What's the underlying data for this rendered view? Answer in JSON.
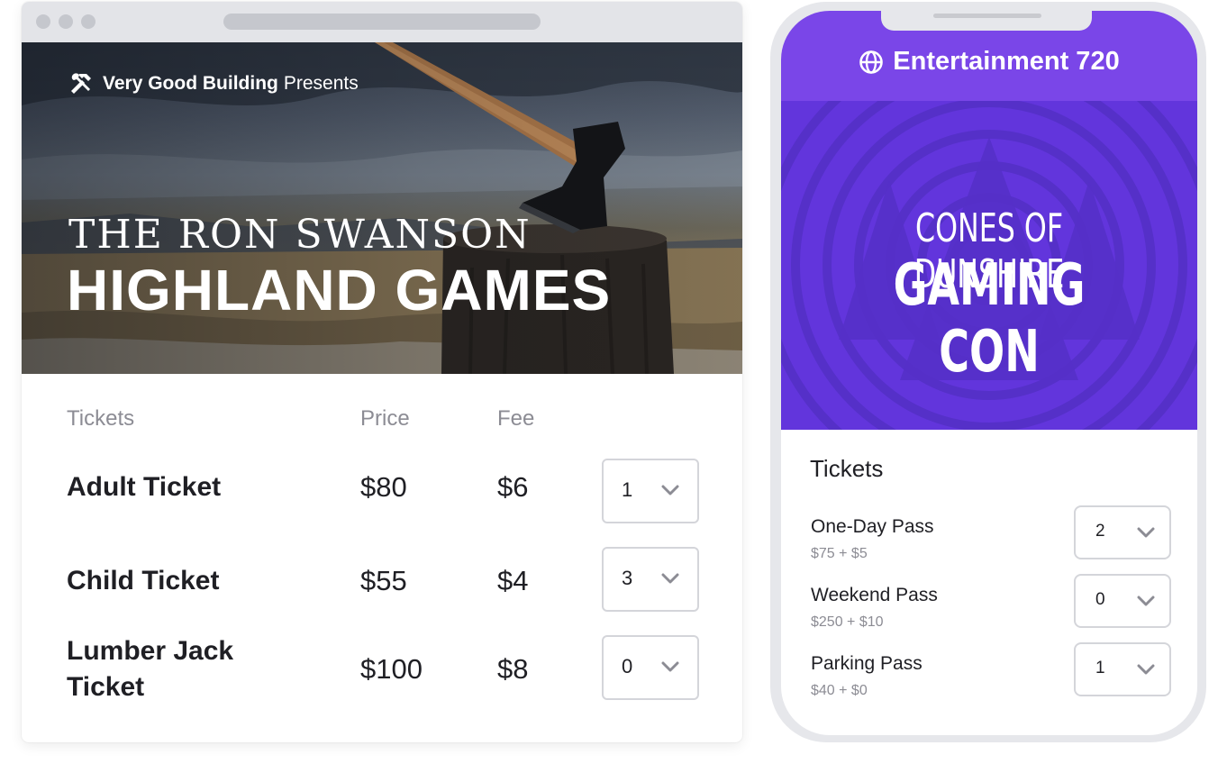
{
  "desktop": {
    "presenter": {
      "org": "Very Good Building",
      "suffix": "Presents"
    },
    "event": {
      "subtitle": "THE RON SWANSON",
      "title": "HIGHLAND GAMES"
    },
    "columns": {
      "tickets": "Tickets",
      "price": "Price",
      "fee": "Fee"
    },
    "tickets": [
      {
        "name": "Adult Ticket",
        "price": "$80",
        "fee": "$6",
        "qty": "1"
      },
      {
        "name": "Child Ticket",
        "price": "$55",
        "fee": "$4",
        "qty": "3"
      },
      {
        "name_line1": "Lumber Jack",
        "name_line2": "Ticket",
        "price": "$100",
        "fee": "$8",
        "qty": "0"
      }
    ]
  },
  "mobile": {
    "app_title": "Entertainment 720",
    "event": {
      "subtitle": "CONES OF DUNSHIRE",
      "title": "GAMING CON"
    },
    "tickets_heading": "Tickets",
    "tickets": [
      {
        "name": "One-Day Pass",
        "price": "$75 + $5",
        "qty": "2"
      },
      {
        "name": "Weekend Pass",
        "price": "$250 + $10",
        "qty": "0"
      },
      {
        "name": "Parking Pass",
        "price": "$40 + $0",
        "qty": "1"
      }
    ]
  },
  "colors": {
    "brand_purple": "#7a46e8",
    "promo_purple": "#6235dc",
    "text_dark": "#1f1f24",
    "text_muted": "#8c8c94"
  }
}
